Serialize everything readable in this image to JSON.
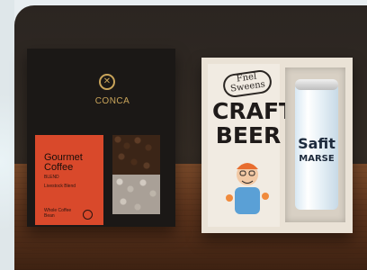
{
  "coffee_box": {
    "brand": "CONCA",
    "logo_icon": "monogram-circle-icon",
    "product_title": "Gourmet Coffee",
    "sub_small_1": "BLEND",
    "sub_small_2": "Livestock Blend",
    "sub_small_3": "Whole Coffee Bean"
  },
  "beer_box": {
    "script_badge": "Fnel Sweens",
    "title_line_1": "CRAFT",
    "title_line_2": "BEER",
    "can_line_1": "Safit",
    "can_line_2": "MARSE"
  }
}
